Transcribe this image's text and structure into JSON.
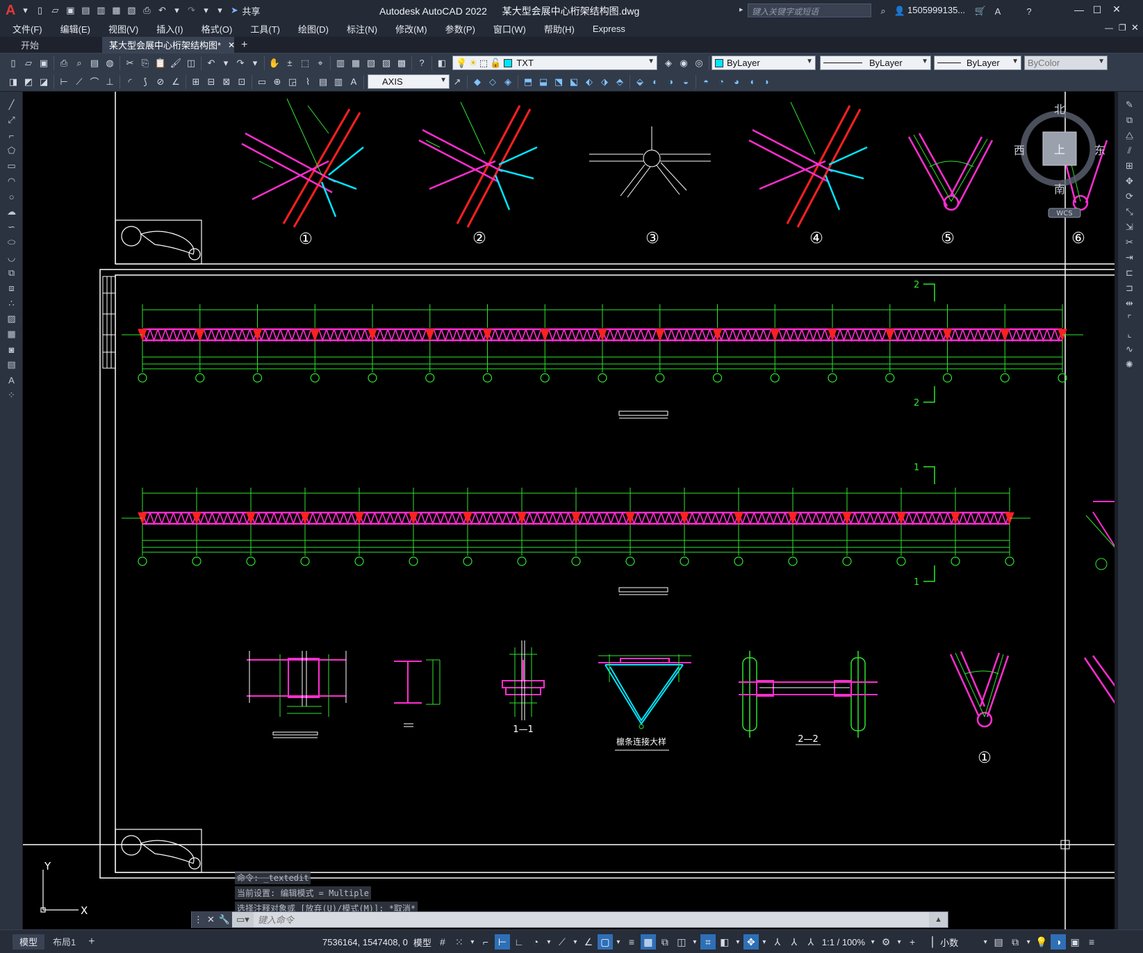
{
  "window": {
    "app_title": "Autodesk AutoCAD 2022",
    "doc_title": "某大型会展中心桁架结构图.dwg",
    "search_placeholder": "键入关键字或短语",
    "user": "1505999135...",
    "share_label": "共享"
  },
  "menu": [
    "文件(F)",
    "编辑(E)",
    "视图(V)",
    "插入(I)",
    "格式(O)",
    "工具(T)",
    "绘图(D)",
    "标注(N)",
    "修改(M)",
    "参数(P)",
    "窗口(W)",
    "帮助(H)",
    "Express"
  ],
  "tabs": {
    "start": "开始",
    "active": "某大型会展中心桁架结构图*"
  },
  "toolbar": {
    "layer": "TXT",
    "textstyle": "AXIS",
    "color": "ByLayer",
    "linetype": "ByLayer",
    "lineweight": "ByLayer",
    "plotstyle": "ByColor"
  },
  "viewcube": {
    "north": "北",
    "south": "南",
    "east": "东",
    "west": "西",
    "top": "上",
    "wcs": "WCS"
  },
  "drawing": {
    "detail_numbers": [
      "①",
      "②",
      "③",
      "④",
      "⑤",
      "⑥"
    ],
    "section_marks": {
      "s2": "2",
      "s1": "1"
    },
    "section_labels": [
      "1—1",
      "2—2"
    ],
    "purlin_detail": "檩条连接大样",
    "bottom_detail_number": "①"
  },
  "ucs": {
    "y": "Y",
    "x": "X"
  },
  "command": {
    "history": [
      "命令: _textedit",
      "当前设置: 编辑模式 = Multiple",
      "选择注释对象或 [放弃(U)/模式(M)]: *取消*"
    ],
    "placeholder": "键入命令"
  },
  "status": {
    "model_tab": "模型",
    "layout_tab": "布局1",
    "coords": "7536164, 1547408, 0",
    "model_label": "模型",
    "scale": "1:1 / 100%",
    "units": "小数"
  }
}
